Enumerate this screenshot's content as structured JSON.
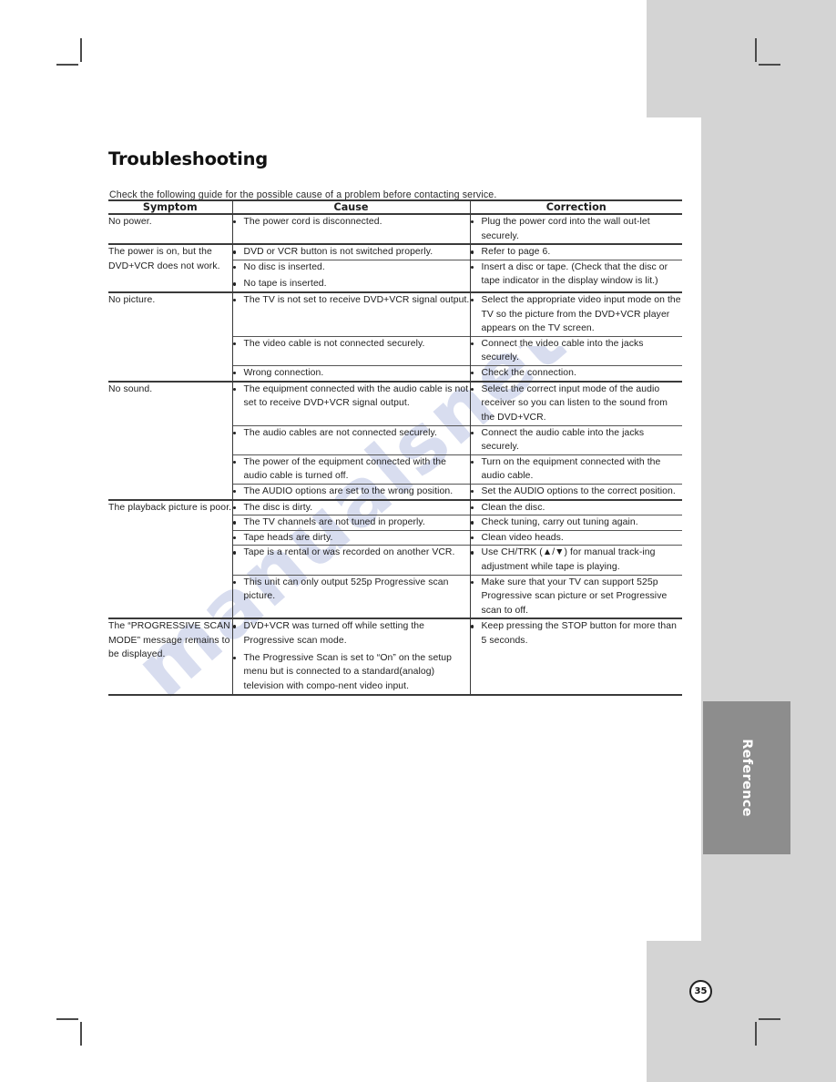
{
  "page": {
    "title": "Troubleshooting",
    "intro": "Check the following guide for the possible cause of a problem before contacting service.",
    "number": "35",
    "side_tab_label": "Reference",
    "watermark_text": "manualsnet.com"
  },
  "table": {
    "headers": {
      "symptom": "Symptom",
      "cause": "Cause",
      "correction": "Correction"
    },
    "groups": [
      {
        "symptom": "No power.",
        "rows": [
          {
            "causes": [
              "The power cord is disconnected."
            ],
            "corrections": [
              "Plug the power cord into the wall out-let securely."
            ]
          }
        ]
      },
      {
        "symptom": "The power is on, but the DVD+VCR does not work.",
        "rows": [
          {
            "causes": [
              "DVD or VCR button is not switched properly."
            ],
            "corrections": [
              "Refer to page 6."
            ]
          },
          {
            "causes": [
              "No disc is inserted.",
              "No tape is inserted."
            ],
            "corrections": [
              "Insert a disc or tape. (Check that the disc or tape indicator in the display window is lit.)"
            ]
          }
        ]
      },
      {
        "symptom": "No picture.",
        "rows": [
          {
            "causes": [
              "The TV is not set to receive DVD+VCR signal output."
            ],
            "corrections": [
              "Select the appropriate video input mode on the TV so the picture from the DVD+VCR player appears on the TV screen."
            ]
          },
          {
            "causes": [
              "The video cable is not connected securely."
            ],
            "corrections": [
              "Connect the video cable into the jacks securely."
            ]
          },
          {
            "causes": [
              "Wrong connection."
            ],
            "corrections": [
              "Check the connection."
            ]
          }
        ]
      },
      {
        "symptom": "No sound.",
        "rows": [
          {
            "causes": [
              "The equipment connected with the audio cable is not set to receive DVD+VCR signal output."
            ],
            "corrections": [
              "Select the correct input mode of the audio receiver so you can listen to the sound from the DVD+VCR."
            ]
          },
          {
            "causes": [
              "The audio cables are not connected securely."
            ],
            "corrections": [
              "Connect the audio cable into the jacks securely."
            ]
          },
          {
            "causes": [
              "The power of the equipment connected with the audio cable is turned off."
            ],
            "corrections": [
              "Turn on the equipment connected with the audio cable."
            ]
          },
          {
            "causes": [
              "The AUDIO options are set to the wrong position."
            ],
            "corrections": [
              "Set the AUDIO options to the correct position."
            ]
          }
        ]
      },
      {
        "symptom": "The playback picture is poor.",
        "rows": [
          {
            "causes": [
              "The disc is dirty."
            ],
            "corrections": [
              "Clean the disc."
            ]
          },
          {
            "causes": [
              "The TV channels are not tuned in properly."
            ],
            "corrections": [
              "Check tuning, carry out tuning again."
            ]
          },
          {
            "causes": [
              "Tape heads are dirty."
            ],
            "corrections": [
              "Clean video heads."
            ]
          },
          {
            "causes": [
              "Tape is a rental or was recorded on another VCR."
            ],
            "corrections": [
              "Use CH/TRK (▲/▼) for manual track-ing adjustment while tape is playing."
            ]
          },
          {
            "causes": [
              "This unit can only output 525p Progressive scan picture."
            ],
            "corrections": [
              "Make sure that your TV can support 525p Progressive scan picture or set Progressive scan to off."
            ]
          }
        ]
      },
      {
        "symptom": "The “PROGRESSIVE SCAN MODE” message remains to be displayed.",
        "rows": [
          {
            "causes": [
              "DVD+VCR was turned off while setting the Progressive scan mode.",
              "The Progressive Scan is set to “On” on the setup menu but is connected to a standard(analog) television with compo-nent video input."
            ],
            "corrections": [
              "Keep pressing the STOP button for more than 5 seconds."
            ]
          }
        ]
      }
    ]
  }
}
